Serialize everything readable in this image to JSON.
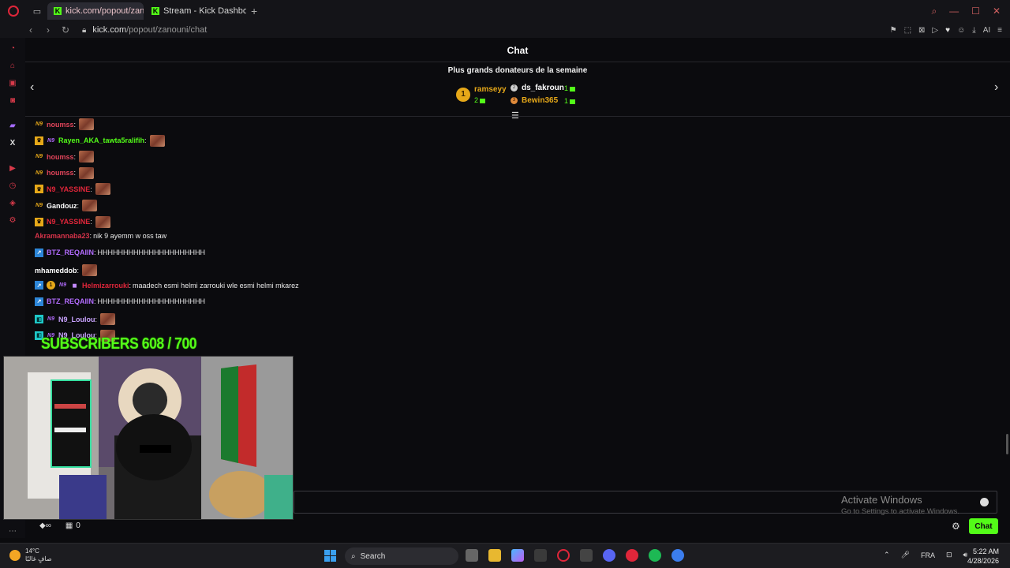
{
  "browser": {
    "tabs": [
      {
        "label": "kick.com/popout/zanouni/",
        "active": true
      },
      {
        "label": "Stream - Kick Dashboard",
        "active": false
      }
    ],
    "url_host": "kick.com",
    "url_path": "/popout/zanouni/chat",
    "new_tab_symbol": "+",
    "ext_ai_label": "AI"
  },
  "chat": {
    "title": "Chat",
    "donors_heading": "Plus grands donateurs de la semaine",
    "top_donors": [
      {
        "rank": "1",
        "name": "ramseyy",
        "count": "2",
        "color": "#e6a819"
      },
      {
        "name": "ds_fakroun",
        "count": "1",
        "color": "#ffffff"
      },
      {
        "name": "Bewin365",
        "count": "1",
        "color": "#e6a819"
      }
    ],
    "messages": [
      {
        "user": "noumss",
        "color": "#e0445a",
        "badges": [
          "nine"
        ],
        "text": "",
        "emote": true
      },
      {
        "user": "Rayen_AKA_tawta5ralifih",
        "color": "#53fc18",
        "badges": [
          "crown",
          "nine.p"
        ],
        "text": "",
        "emote": true
      },
      {
        "user": "houmss",
        "color": "#e0445a",
        "badges": [
          "nine"
        ],
        "text": "",
        "emote": true
      },
      {
        "user": "houmss",
        "color": "#e0445a",
        "badges": [
          "nine"
        ],
        "text": "",
        "emote": true
      },
      {
        "user": "N9_YASSINE",
        "color": "#e0263a",
        "badges": [
          "crown"
        ],
        "text": "",
        "emote": true
      },
      {
        "user": "Gandouz",
        "color": "#ffffff",
        "badges": [
          "nine"
        ],
        "text": "",
        "emote": true
      },
      {
        "user": "N9_YASSINE",
        "color": "#e0263a",
        "badges": [
          "crown"
        ],
        "text": "",
        "emote": true
      },
      {
        "user": "Akramannaba23",
        "color": "#d6334a",
        "badges": [],
        "text": "nik 9 ayemm w oss taw",
        "emote": false
      },
      {
        "user": "BTZ_REQAIIN",
        "color": "#b36cff",
        "badges": [
          "blue"
        ],
        "text": "HHHHHHHHHHHHHHHHHHHHH",
        "emote": false
      },
      {
        "user": "mhameddob",
        "color": "#ffffff",
        "badges": [],
        "text": "",
        "emote": true
      },
      {
        "user": "Helmizarrouki",
        "color": "#e0263a",
        "badges": [
          "blue",
          "gold",
          "nine.p",
          "gift"
        ],
        "text": "maadech esmi helmi zarrouki wle esmi helmi mkarez",
        "emote": false
      },
      {
        "user": "BTZ_REQAIIN",
        "color": "#b36cff",
        "badges": [
          "blue"
        ],
        "text": "HHHHHHHHHHHHHHHHHHHHH",
        "emote": false
      },
      {
        "user": "N9_Loulou",
        "color": "#c9a3ff",
        "badges": [
          "teal",
          "nine.p"
        ],
        "text": "",
        "emote": true
      },
      {
        "user": "N9_Loulou",
        "color": "#c9a3ff",
        "badges": [
          "teal",
          "nine.p"
        ],
        "text": "",
        "emote": true
      }
    ],
    "overlay_subscribers": "SUBSCRIBERS 608 / 700",
    "bottom_count": "0",
    "chat_button": "Chat"
  },
  "watermark": {
    "title": "Activate Windows",
    "subtitle": "Go to Settings to activate Windows."
  },
  "taskbar": {
    "temperature": "14°C",
    "weather_desc": "صافٍ غالبًا",
    "search_label": "Search",
    "language": "FRA",
    "time": "5:22 AM",
    "date": "4/28/2026"
  }
}
